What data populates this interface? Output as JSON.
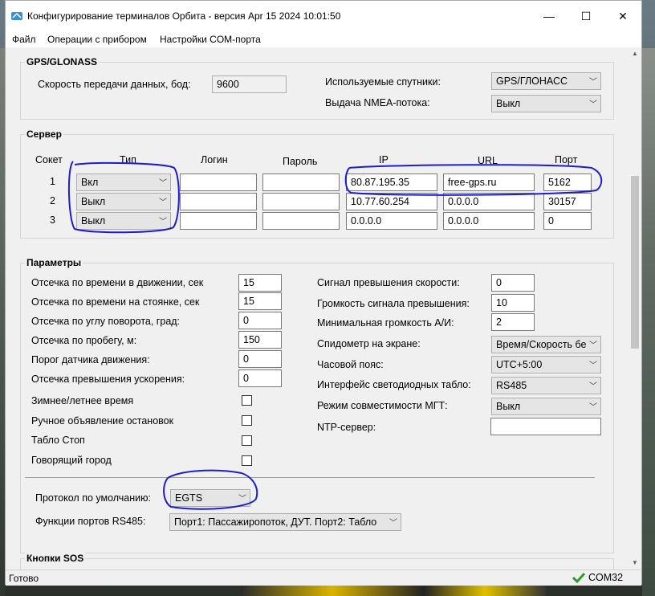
{
  "window": {
    "title": "Конфигурирование терминалов Орбита - версия Apr 15 2024 10:01:50",
    "minimize": "—",
    "maximize": "☐",
    "close": "✕"
  },
  "menu": [
    "Файл",
    "Операции с прибором",
    "Настройки COM-порта"
  ],
  "gps": {
    "title": "GPS/GLONASS",
    "baud_label": "Скорость передачи данных, бод:",
    "baud_value": "9600",
    "sat_label": "Используемые спутники:",
    "sat_value": "GPS/ГЛОНАСС",
    "nmea_label": "Выдача NMEA-потока:",
    "nmea_value": "Выкл"
  },
  "server": {
    "title": "Сервер",
    "headers": {
      "socket": "Сокет",
      "type": "Тип",
      "login": "Логин",
      "password": "Пароль",
      "ip": "IP",
      "url": "URL",
      "port": "Порт"
    },
    "rows": [
      {
        "n": "1",
        "type": "Вкл",
        "login": "",
        "password": "",
        "ip": "80.87.195.35",
        "url": "free-gps.ru",
        "port": "5162"
      },
      {
        "n": "2",
        "type": "Выкл",
        "login": "",
        "password": "",
        "ip": "10.77.60.254",
        "url": "0.0.0.0",
        "port": "30157"
      },
      {
        "n": "3",
        "type": "Выкл",
        "login": "",
        "password": "",
        "ip": "0.0.0.0",
        "url": "0.0.0.0",
        "port": "0"
      }
    ]
  },
  "params": {
    "title": "Параметры",
    "left": [
      {
        "label": "Отсечка по времени в движении, сек",
        "value": "15"
      },
      {
        "label": "Отсечка по времени на стоянке, сек",
        "value": "15"
      },
      {
        "label": "Отсечка по углу поворота, град:",
        "value": "0"
      },
      {
        "label": "Отсечка по пробегу, м:",
        "value": "150"
      },
      {
        "label": "Порог датчика движения:",
        "value": "0"
      },
      {
        "label": "Отсечка превышения ускорения:",
        "value": "0"
      }
    ],
    "checks": [
      {
        "label": "Зимнее/летнее время",
        "checked": false
      },
      {
        "label": "Ручное объявление остановок",
        "checked": false
      },
      {
        "label": "Табло Стоп",
        "checked": false
      },
      {
        "label": "Говорящий город",
        "checked": false
      }
    ],
    "right": [
      {
        "label": "Сигнал превышения скорости:",
        "value": "0"
      },
      {
        "label": "Громкость сигнала превышения:",
        "value": "10"
      },
      {
        "label": "Минимальная громкость А/И:",
        "value": "2"
      }
    ],
    "right_combos": [
      {
        "label": "Спидометр на экране:",
        "value": "Время/Скорость бе"
      },
      {
        "label": "Часовой пояс:",
        "value": "UTC+5:00"
      },
      {
        "label": "Интерфейс светодиодных табло:",
        "value": "RS485"
      },
      {
        "label": "Режим совместимости МГТ:",
        "value": "Выкл"
      }
    ],
    "ntp_label": "NTP-сервер:",
    "ntp_value": "",
    "protocol_label": "Протокол по умолчанию:",
    "protocol_value": "EGTS",
    "rs485_label": "Функции портов RS485:",
    "rs485_value": "Порт1: Пассажиропоток, ДУТ. Порт2: Табло"
  },
  "sos": {
    "title": "Кнопки SOS"
  },
  "status": {
    "text": "Готово",
    "port": "COM32"
  },
  "colors": {
    "annotation": "#1d1dcf",
    "check_green": "#2e9b2e"
  }
}
